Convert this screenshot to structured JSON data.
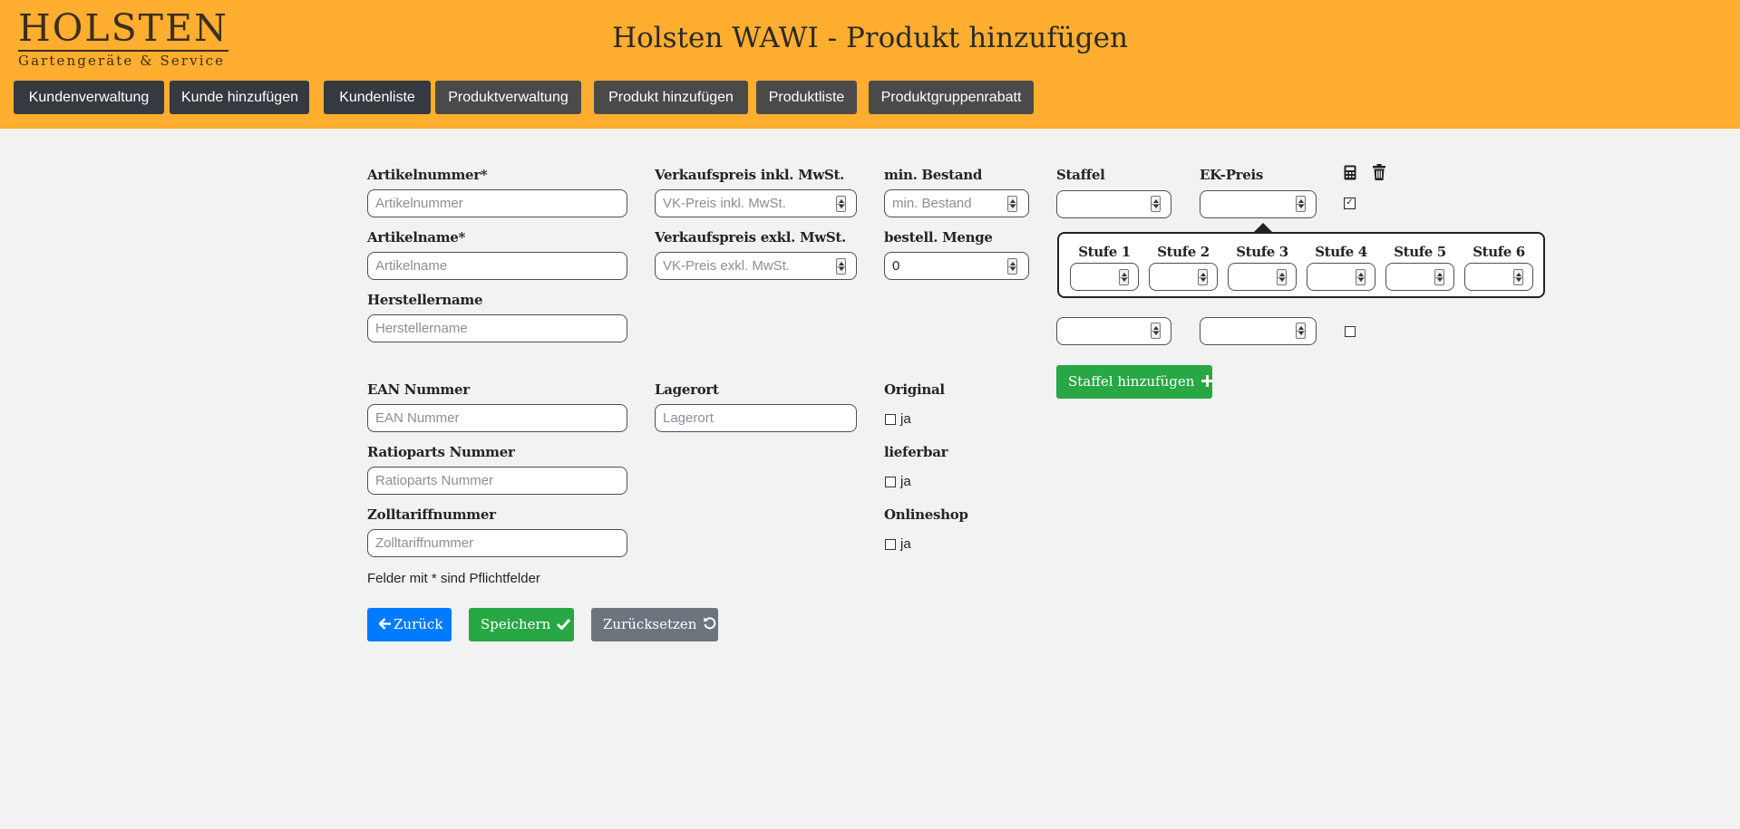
{
  "header": {
    "logo_main": "HOLSTEN",
    "logo_sub": "Gartengeräte & Service",
    "title": "Holsten WAWI - Produkt hinzufügen"
  },
  "nav": [
    {
      "label": "Kundenverwaltung",
      "style": "dark"
    },
    {
      "label": "Kunde hinzufügen",
      "style": "dark"
    },
    {
      "label": "Kundenliste",
      "style": "dark"
    },
    {
      "label": "Produktverwaltung",
      "style": "grey"
    },
    {
      "label": "Produkt hinzufügen",
      "style": "grey"
    },
    {
      "label": "Produktliste",
      "style": "grey"
    },
    {
      "label": "Produktgruppenrabatt",
      "style": "grey"
    }
  ],
  "form": {
    "artikelnummer": {
      "label": "Artikelnummer*",
      "placeholder": "Artikelnummer"
    },
    "artikelname": {
      "label": "Artikelname*",
      "placeholder": "Artikelname"
    },
    "herstellername": {
      "label": "Herstellername",
      "placeholder": "Herstellername"
    },
    "vk_inkl": {
      "label": "Verkaufspreis inkl. MwSt.",
      "placeholder": "VK-Preis inkl. MwSt."
    },
    "vk_exkl": {
      "label": "Verkaufspreis exkl. MwSt.",
      "placeholder": "VK-Preis exkl. MwSt."
    },
    "min_bestand": {
      "label": "min. Bestand",
      "placeholder": "min. Bestand"
    },
    "bestell_menge": {
      "label": "bestell. Menge",
      "value": "0"
    },
    "ean": {
      "label": "EAN Nummer",
      "placeholder": "EAN Nummer"
    },
    "ratioparts": {
      "label": "Ratioparts Nummer",
      "placeholder": "Ratioparts Nummer"
    },
    "zolltarif": {
      "label": "Zolltariffnummer",
      "placeholder": "Zolltariffnummer"
    },
    "lagerort": {
      "label": "Lagerort",
      "placeholder": "Lagerort"
    },
    "original": {
      "label": "Original",
      "option": "ja"
    },
    "lieferbar": {
      "label": "lieferbar",
      "option": "ja"
    },
    "onlineshop": {
      "label": "Onlineshop",
      "option": "ja"
    },
    "note": "Felder mit * sind Pflichtfelder"
  },
  "staffel": {
    "label_staffel": "Staffel",
    "label_ek": "EK-Preis",
    "calculator_icon": "calculator-icon",
    "trash_icon": "trash-icon",
    "stufen": [
      "Stufe 1",
      "Stufe 2",
      "Stufe 3",
      "Stufe 4",
      "Stufe 5",
      "Stufe 6"
    ],
    "add_button": "Staffel hinzufügen"
  },
  "actions": {
    "back": "Zurück",
    "save": "Speichern",
    "reset": "Zurücksetzen"
  },
  "colors": {
    "header": "#ffae2f",
    "background": "#f2f2f2",
    "primary": "#007bff",
    "success": "#28a745",
    "secondary": "#6c757d",
    "nav_dark": "#343a40"
  }
}
